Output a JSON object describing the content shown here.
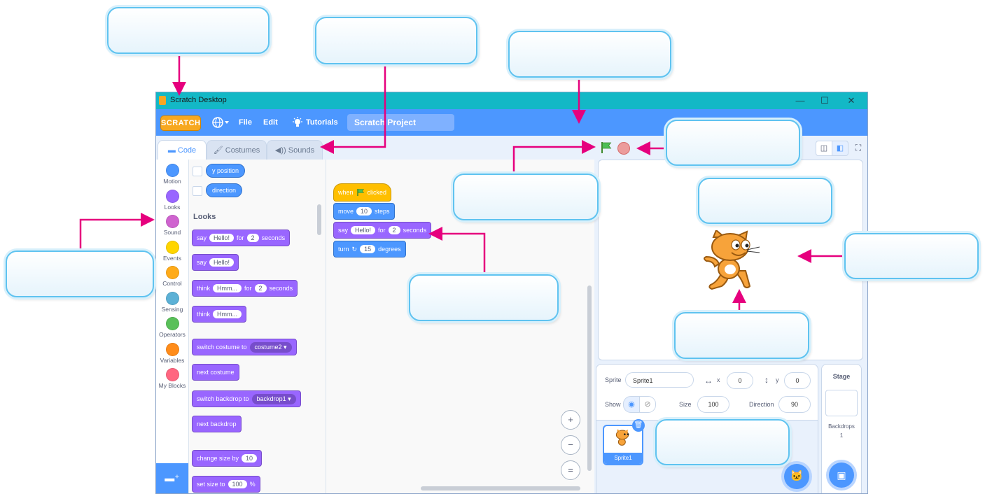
{
  "window": {
    "title": "Scratch Desktop",
    "minimize": "—",
    "maximize": "☐",
    "close": "✕"
  },
  "menu": {
    "logo": "SCRATCH",
    "file": "File",
    "edit": "Edit",
    "tutorials": "Tutorials",
    "project_name": "Scratch Project"
  },
  "tabs": [
    {
      "label": "Code"
    },
    {
      "label": "Costumes"
    },
    {
      "label": "Sounds"
    }
  ],
  "categories": [
    {
      "label": "Motion",
      "color": "#4c97ff"
    },
    {
      "label": "Looks",
      "color": "#9966ff"
    },
    {
      "label": "Sound",
      "color": "#cf63cf"
    },
    {
      "label": "Events",
      "color": "#ffd500"
    },
    {
      "label": "Control",
      "color": "#ffab19"
    },
    {
      "label": "Sensing",
      "color": "#5cb1d6"
    },
    {
      "label": "Operators",
      "color": "#59c059"
    },
    {
      "label": "Variables",
      "color": "#ff8c1a"
    },
    {
      "label": "My Blocks",
      "color": "#ff6680"
    }
  ],
  "palette": {
    "motion_reporters": [
      "y position",
      "direction"
    ],
    "section_title": "Looks",
    "blocks": {
      "say_for": {
        "say": "say",
        "text": "Hello!",
        "for": "for",
        "secs": "2",
        "unit": "seconds"
      },
      "say": {
        "say": "say",
        "text": "Hello!"
      },
      "think_for": {
        "think": "think",
        "text": "Hmm...",
        "for": "for",
        "secs": "2",
        "unit": "seconds"
      },
      "think": {
        "think": "think",
        "text": "Hmm..."
      },
      "switch_costume": {
        "label": "switch costume to",
        "value": "costume2 ▾"
      },
      "next_costume": "next costume",
      "switch_backdrop": {
        "label": "switch backdrop to",
        "value": "backdrop1 ▾"
      },
      "next_backdrop": "next backdrop",
      "change_size": {
        "label": "change size by",
        "value": "10"
      },
      "set_size": {
        "label": "set size to",
        "value": "100",
        "unit": "%"
      }
    }
  },
  "script": {
    "when_flag": {
      "when": "when",
      "clicked": "clicked"
    },
    "move": {
      "label": "move",
      "value": "10",
      "unit": "steps"
    },
    "say_for": {
      "say": "say",
      "text": "Hello!",
      "for": "for",
      "secs": "2",
      "unit": "seconds"
    },
    "turn": {
      "label": "turn",
      "icon": "↻",
      "value": "15",
      "unit": "degrees"
    },
    "zoom_in": "+",
    "zoom_out": "−",
    "zoom_reset": "="
  },
  "sprite_info": {
    "sprite_label": "Sprite",
    "sprite_name": "Sprite1",
    "x_label": "x",
    "x_value": "0",
    "y_label": "y",
    "y_value": "0",
    "show_label": "Show",
    "size_label": "Size",
    "size_value": "100",
    "direction_label": "Direction",
    "direction_value": "90"
  },
  "sprite_list": {
    "thumb_label": "Sprite1"
  },
  "stage_panel": {
    "title": "Stage",
    "backdrops_label": "Backdrops",
    "backdrops_count": "1"
  }
}
